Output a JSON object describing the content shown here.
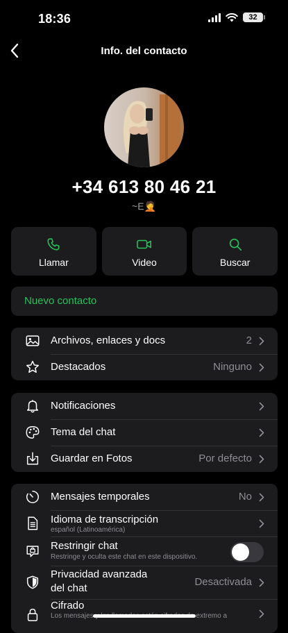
{
  "status": {
    "time": "18:36",
    "battery": "32"
  },
  "nav": {
    "title": "Info. del contacto"
  },
  "contact": {
    "phone": "+34 613 80 46 21",
    "name": "~E🤦"
  },
  "actions": {
    "call": "Llamar",
    "video": "Video",
    "search": "Buscar"
  },
  "new_contact": "Nuevo contacto",
  "media": {
    "files_label": "Archivos, enlaces y docs",
    "files_count": "2",
    "starred_label": "Destacados",
    "starred_value": "Ninguno"
  },
  "settings": {
    "notifications": "Notificaciones",
    "theme": "Tema del chat",
    "save_photos": "Guardar en Fotos",
    "save_photos_value": "Por defecto"
  },
  "privacy": {
    "temp_label": "Mensajes temporales",
    "temp_value": "No",
    "transcription_label": "Idioma de transcripción",
    "transcription_sub": "español (Latinoamérica)",
    "restrict_label": "Restringir chat",
    "restrict_sub": "Restringe y oculta este chat en este dispositivo.",
    "restrict_on": false,
    "advanced_label_1": "Privacidad avanzada",
    "advanced_label_2": "del chat",
    "advanced_value": "Desactivada",
    "encryption_label": "Cifrado",
    "encryption_sub": "Los mensajes y las llamadas están cifrados de extremo a"
  },
  "colors": {
    "accent": "#25c35a",
    "card": "#1c1c1e",
    "background": "#000000"
  },
  "icons": [
    "back-icon",
    "phone-icon",
    "video-icon",
    "search-icon",
    "image-icon",
    "star-icon",
    "bell-icon",
    "palette-icon",
    "download-icon",
    "timer-icon",
    "document-icon",
    "restrict-icon",
    "shield-icon",
    "lock-icon",
    "chevron-right-icon"
  ]
}
